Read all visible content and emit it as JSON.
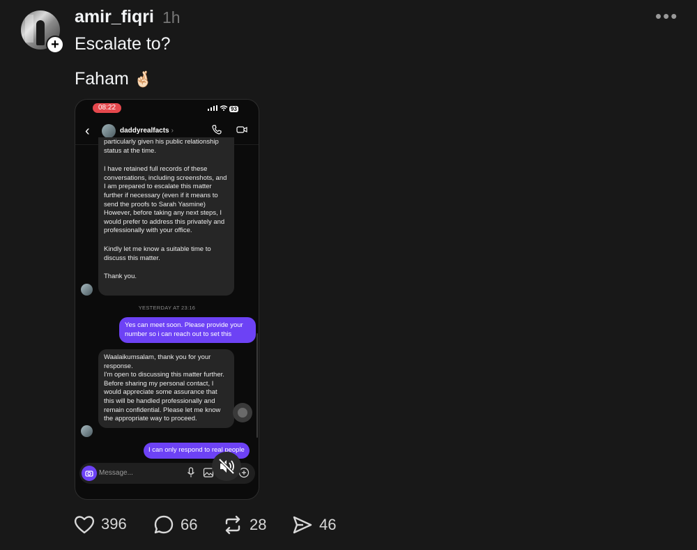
{
  "post": {
    "username": "amir_fiqri",
    "time": "1h",
    "more": "•••",
    "text_line1": "Escalate to?",
    "text_line2": "Faham",
    "emoji": "🤞🏻"
  },
  "screenshot": {
    "status_time": "08:22",
    "battery": "93",
    "contact_name": "daddyrealfacts",
    "message1_partial": "particularly given his public relationship status at the time.",
    "message1_p2": "I have retained full records of these conversations, including screenshots, and I am prepared to escalate this matter further if necessary (even if it means to send the proofs to Sarah Yasmine) However, before taking any next steps, I would prefer to address this privately and professionally with your office.",
    "message1_p3": "Kindly let me know a suitable time to discuss this matter.",
    "message1_p4": "Thank you.",
    "timestamp": "YESTERDAY AT 23:16",
    "message2": "Yes can meet soon. Please provide your number so i can reach out to set this",
    "message3": "Waalaikumsalam, thank you for your response.\nI'm open to discussing this matter further. Before sharing my personal contact, I would appreciate some assurance that this will be handled professionally and remain confidential. Please let me know the appropriate way to proceed.",
    "message4": "I can only respond to real people",
    "composer_placeholder": "Message..."
  },
  "actions": {
    "likes": "396",
    "replies": "66",
    "reposts": "28",
    "shares": "46"
  },
  "colors": {
    "background": "#181818",
    "outgoing_bubble": "#6d42f5",
    "incoming_bubble": "#262626",
    "status_time_pill": "#e5484d"
  }
}
